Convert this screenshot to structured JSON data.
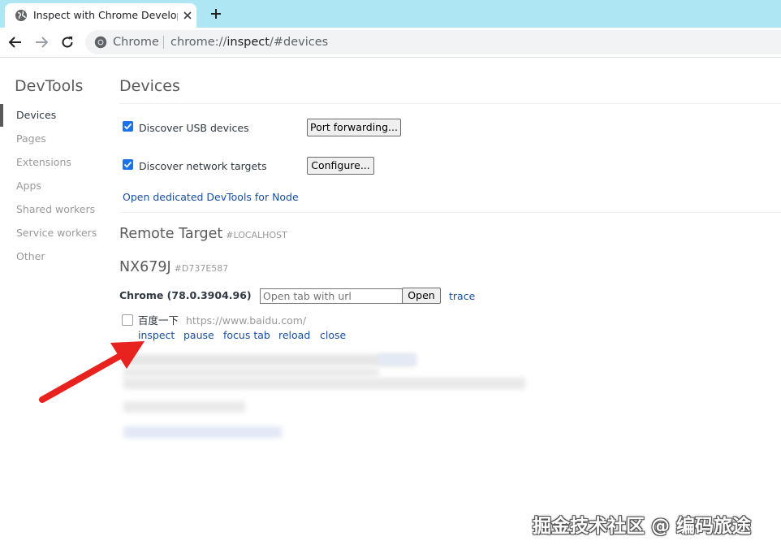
{
  "tab": {
    "title": "Inspect with Chrome Developer Tools",
    "favicon": "globe-icon"
  },
  "toolbar": {
    "omnibox_chip": "Chrome",
    "url_prefix": "chrome://",
    "url_host": "inspect",
    "url_path": "/#devices"
  },
  "sidebar": {
    "title": "DevTools",
    "items": [
      {
        "label": "Devices",
        "active": true
      },
      {
        "label": "Pages"
      },
      {
        "label": "Extensions"
      },
      {
        "label": "Apps"
      },
      {
        "label": "Shared workers"
      },
      {
        "label": "Service workers"
      },
      {
        "label": "Other"
      }
    ]
  },
  "main": {
    "title": "Devices",
    "discover_usb": {
      "label": "Discover USB devices",
      "checked": true,
      "button": "Port forwarding..."
    },
    "discover_network": {
      "label": "Discover network targets",
      "checked": true,
      "button": "Configure..."
    },
    "node_link": "Open dedicated DevTools for Node",
    "remote_target": {
      "title": "Remote Target",
      "tag": "#LOCALHOST"
    },
    "device": {
      "name": "NX679J",
      "id": "#D737E587"
    },
    "browser": {
      "name": "Chrome (78.0.3904.96)",
      "open_placeholder": "Open tab with url",
      "open_button": "Open",
      "trace_link": "trace"
    },
    "target": {
      "title": "百度一下",
      "url": "https://www.baidu.com/",
      "actions": [
        "inspect",
        "pause",
        "focus tab",
        "reload",
        "close"
      ]
    }
  },
  "watermark": "掘金技术社区 @ 编码旅途",
  "colors": {
    "tabstrip": "#aee6f4",
    "link": "#1a4fa0",
    "checkbox": "#1a73e8",
    "arrow": "#e8231f"
  }
}
